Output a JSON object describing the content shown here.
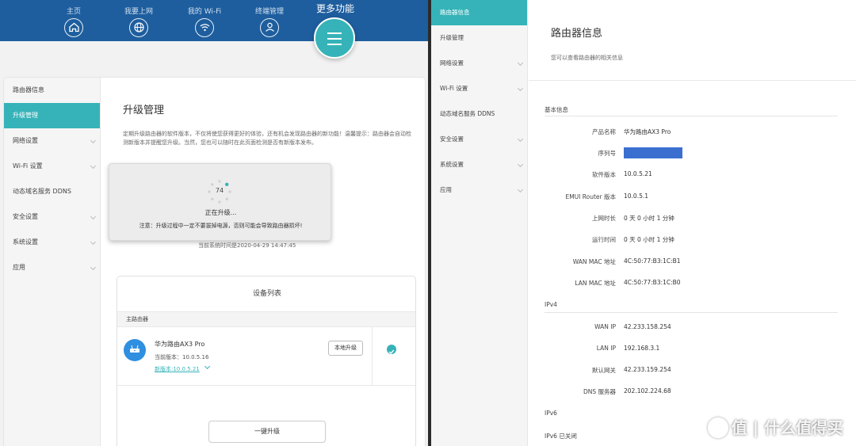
{
  "left": {
    "topnav": {
      "items": [
        {
          "label": "主页",
          "icon": "home-icon"
        },
        {
          "label": "我要上网",
          "icon": "globe-icon"
        },
        {
          "label": "我的 Wi-Fi",
          "icon": "wifi-icon"
        },
        {
          "label": "终端管理",
          "icon": "user-icon"
        }
      ],
      "more_label": "更多功能",
      "more_icon": "menu-icon"
    },
    "sidebar": [
      {
        "label": "路由器信息",
        "active": false,
        "chevron": false
      },
      {
        "label": "升级管理",
        "active": true,
        "chevron": false
      },
      {
        "label": "网络设置",
        "active": false,
        "chevron": true
      },
      {
        "label": "Wi-Fi 设置",
        "active": false,
        "chevron": true
      },
      {
        "label": "动态域名服务 DDNS",
        "active": false,
        "chevron": false
      },
      {
        "label": "安全设置",
        "active": false,
        "chevron": true
      },
      {
        "label": "系统设置",
        "active": false,
        "chevron": true
      },
      {
        "label": "应用",
        "active": false,
        "chevron": true
      }
    ],
    "page_title": "升级管理",
    "page_desc": "定期升级路由器的软件版本，不仅将使您获得更好的体验，还有机会发现路由器的新功能！温馨提示：路由器会自动检测新版本并提醒您升级。当然，您也可以随时在此页面检测是否有新版本发布。",
    "current_time": "当前系统时间是2020-04-29 14:47:45",
    "progress": {
      "value": "74",
      "status": "正在升级...",
      "note": "注意：升级过程中一定不要拔掉电源，否则可能会导致路由器损坏!"
    },
    "device_list": {
      "title": "设备列表",
      "section": "主路由器",
      "device_name": "华为路由AX3 Pro",
      "current_version": "当前版本：10.0.5.16",
      "new_version": "新版本:10.0.5.21",
      "local_upgrade": "本地升级",
      "one_click": "一键升级"
    },
    "accent_color": "#36b3b8",
    "nav_color": "#1e5e9e"
  },
  "right": {
    "sidebar": [
      {
        "label": "路由器信息",
        "active": true,
        "chevron": false
      },
      {
        "label": "升级管理",
        "active": false,
        "chevron": false
      },
      {
        "label": "网络设置",
        "active": false,
        "chevron": true
      },
      {
        "label": "Wi-Fi 设置",
        "active": false,
        "chevron": true
      },
      {
        "label": "动态域名服务 DDNS",
        "active": false,
        "chevron": false
      },
      {
        "label": "安全设置",
        "active": false,
        "chevron": true
      },
      {
        "label": "系统设置",
        "active": false,
        "chevron": true
      },
      {
        "label": "应用",
        "active": false,
        "chevron": true
      }
    ],
    "page_title": "路由器信息",
    "page_desc": "您可以查看路由器的相关信息",
    "sections": {
      "basic": "基本信息",
      "ipv4": "IPv4",
      "ipv6": "IPv6"
    },
    "basic_info": [
      {
        "key": "产品名称",
        "value": "华为路由AX3 Pro"
      },
      {
        "key": "序列号",
        "value": "",
        "redacted": true
      },
      {
        "key": "软件版本",
        "value": "10.0.5.21"
      },
      {
        "key": "EMUI Router 版本",
        "value": "10.0.5.1"
      },
      {
        "key": "上网时长",
        "value": "0 天 0 小时 1 分钟"
      },
      {
        "key": "运行时间",
        "value": "0 天 0 小时 1 分钟"
      },
      {
        "key": "WAN MAC 地址",
        "value": "4C:50:77:B3:1C:B1"
      },
      {
        "key": "LAN MAC 地址",
        "value": "4C:50:77:B3:1C:B0"
      }
    ],
    "ipv4_info": [
      {
        "key": "WAN IP",
        "value": "42.233.158.254"
      },
      {
        "key": "LAN IP",
        "value": "192.168.3.1"
      },
      {
        "key": "默认网关",
        "value": "42.233.159.254"
      },
      {
        "key": "DNS 服务器",
        "value": "202.102.224.68"
      }
    ],
    "ipv6_status": "IPv6 已关闭"
  },
  "watermark": "值 | 什么值得买"
}
